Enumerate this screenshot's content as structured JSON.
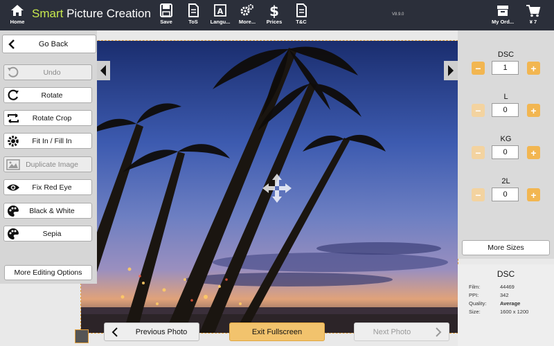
{
  "topbar": {
    "home": "Home",
    "brand_accent": "Smart",
    "brand_rest": " Picture Creation",
    "save": "Save",
    "tos": "ToS",
    "language": "Langu...",
    "more": "More...",
    "prices": "Prices",
    "tc": "T&C",
    "version": "V8.9.0",
    "my_orders": "My Ord...",
    "cart": "¥ 7"
  },
  "left": {
    "go_back": "Go Back",
    "tools": [
      "Undo",
      "Rotate",
      "Rotate Crop",
      "Fit In / Fill In",
      "Duplicate Image",
      "Fix Red Eye",
      "Black & White",
      "Sepia"
    ],
    "more_editing": "More Editing Options"
  },
  "bottom": {
    "previous": "Previous Photo",
    "exit": "Exit Fullscreen",
    "next": "Next Photo"
  },
  "right": {
    "sizes": [
      {
        "label": "DSC",
        "qty": "1"
      },
      {
        "label": "L",
        "qty": "0"
      },
      {
        "label": "KG",
        "qty": "0"
      },
      {
        "label": "2L",
        "qty": "0"
      }
    ],
    "more_sizes": "More Sizes"
  },
  "info": {
    "title": "DSC",
    "film_k": "Film:",
    "film_v": "44469",
    "ppi_k": "PPI:",
    "ppi_v": "342",
    "quality_k": "Quality:",
    "quality_v": "Average",
    "size_k": "Size:",
    "size_v": "1600 x 1200"
  },
  "colors": {
    "accent": "#c7e84d",
    "orange": "#f2b651",
    "topbar": "#2b2f3a"
  }
}
